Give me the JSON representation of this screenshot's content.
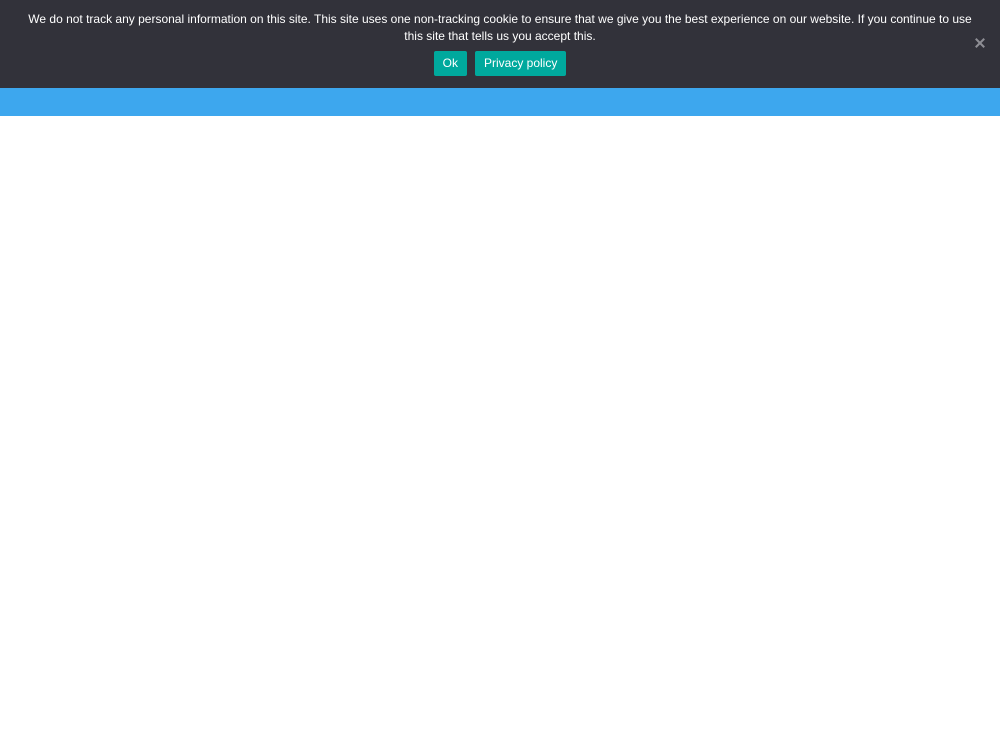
{
  "cookie_notice": {
    "message": "We do not track any personal information on this site. This site uses one non-tracking cookie to ensure that we give you the best experience on our website. If you continue to use this site that tells us you accept this.",
    "ok_label": "Ok",
    "privacy_label": "Privacy policy",
    "close_icon": "close-icon"
  },
  "colors": {
    "banner_background": "#32323a",
    "button_accent": "#00a99d",
    "header_bar": "#3da7ee",
    "page_background": "#ffffff"
  }
}
